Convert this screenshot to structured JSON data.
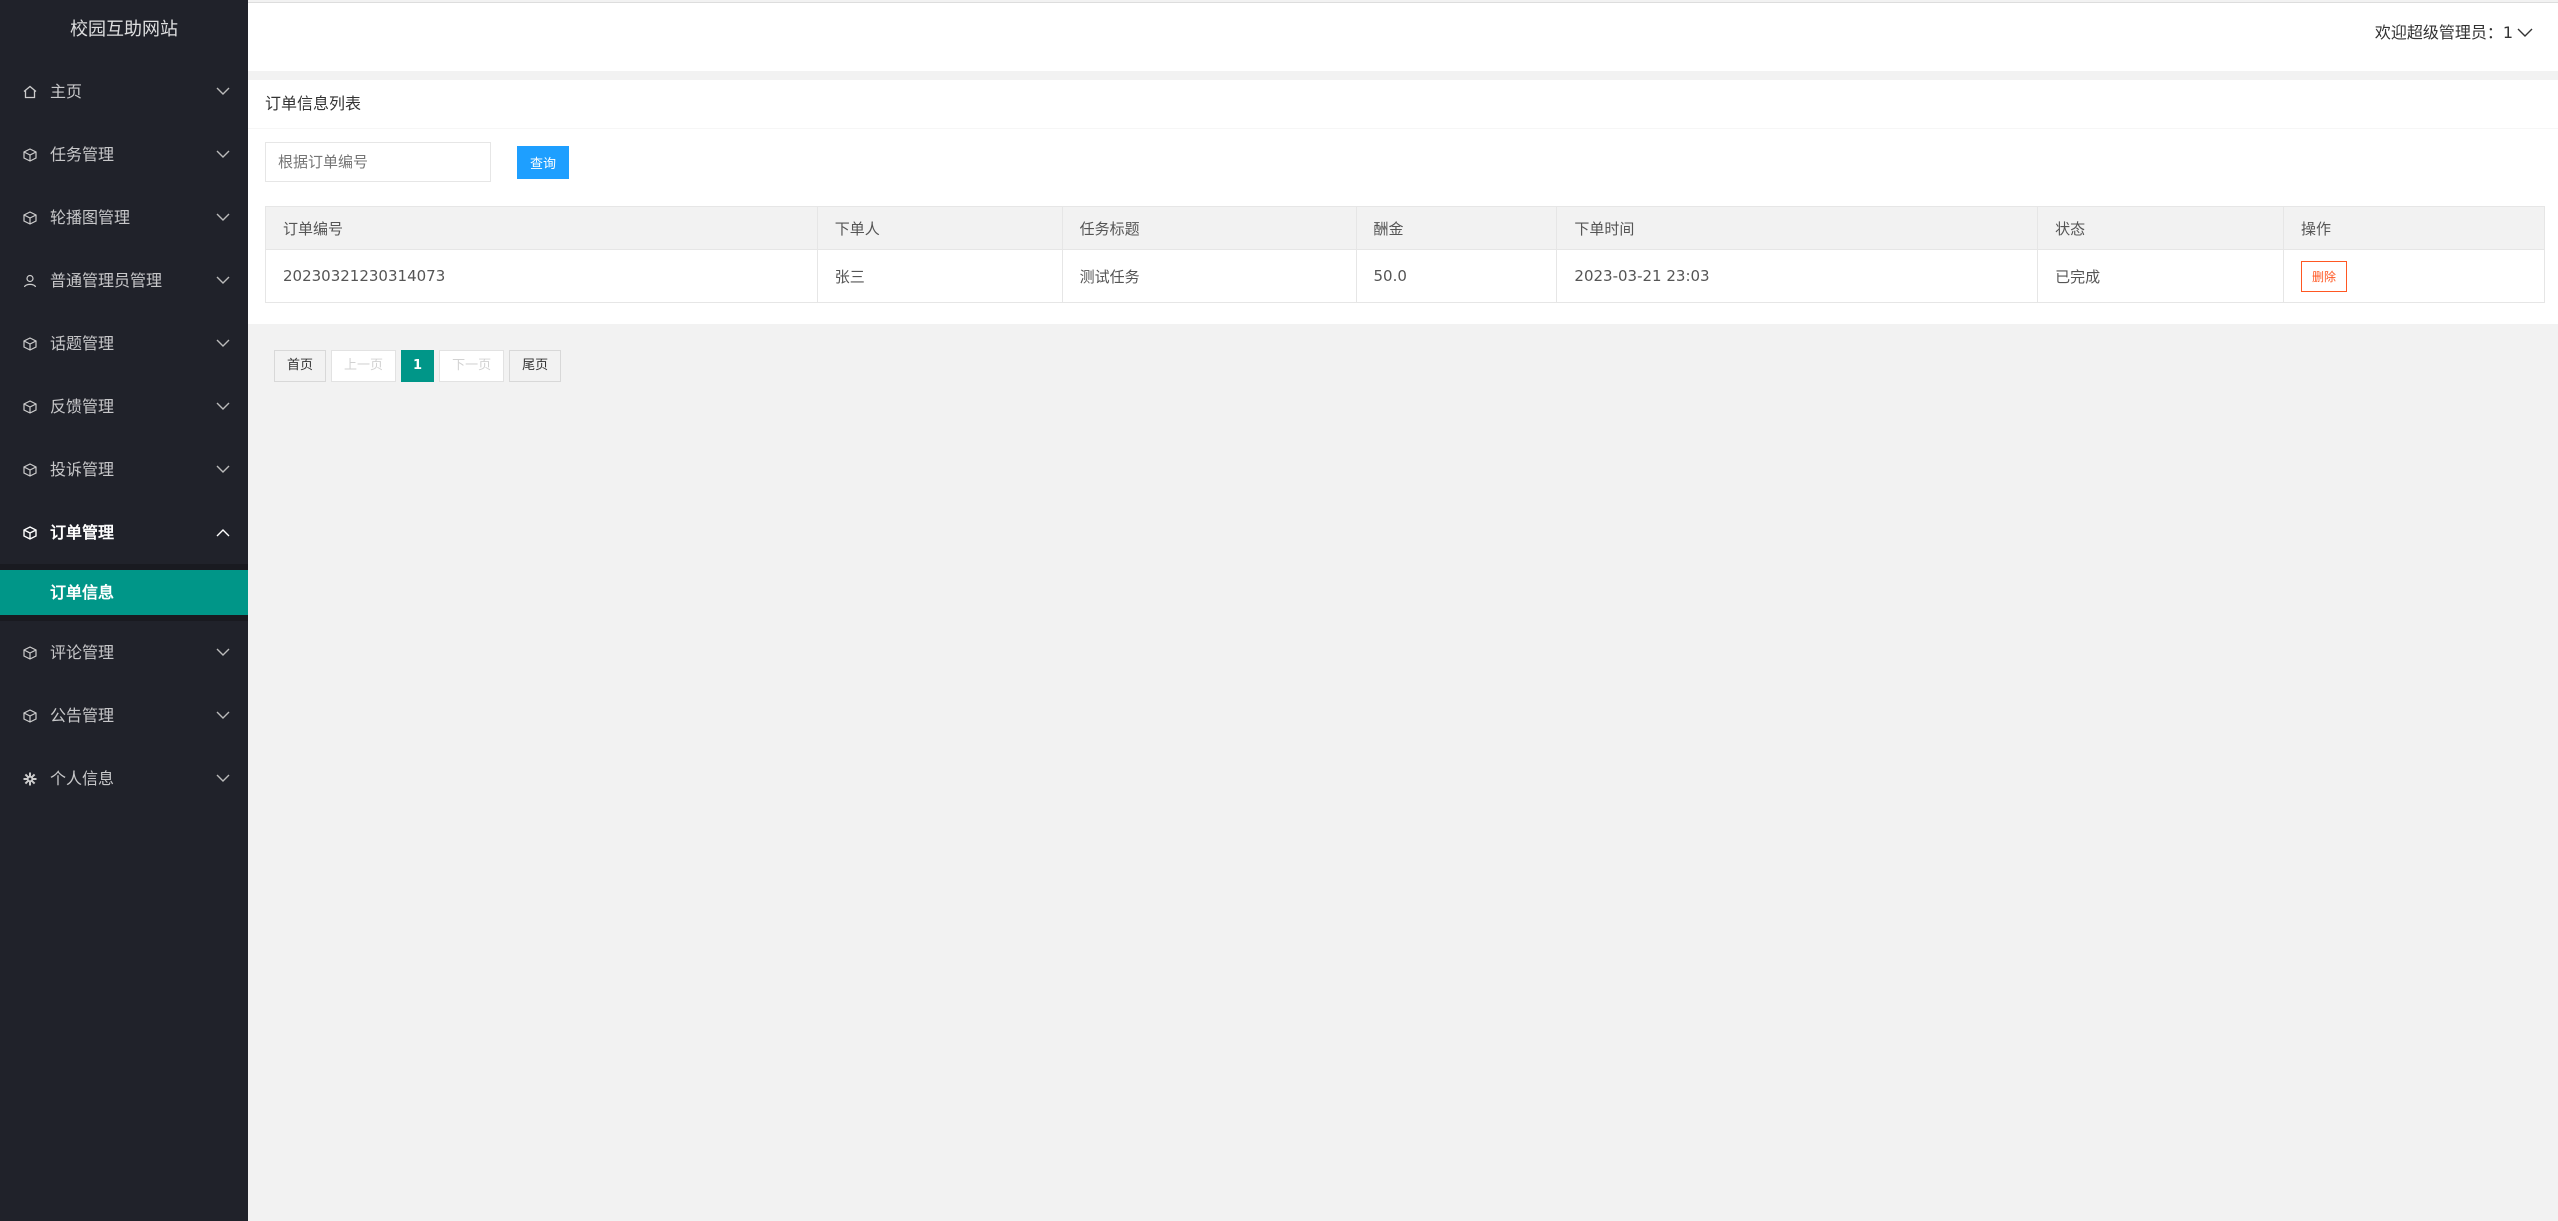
{
  "sidebar": {
    "logo": "校园互助网站",
    "items": [
      {
        "label": "主页",
        "icon": "home-icon"
      },
      {
        "label": "任务管理",
        "icon": "cube-icon"
      },
      {
        "label": "轮播图管理",
        "icon": "cube-icon"
      },
      {
        "label": "普通管理员管理",
        "icon": "user-icon"
      },
      {
        "label": "话题管理",
        "icon": "cube-icon"
      },
      {
        "label": "反馈管理",
        "icon": "cube-icon"
      },
      {
        "label": "投诉管理",
        "icon": "cube-icon"
      },
      {
        "label": "订单管理",
        "icon": "cube-icon",
        "expanded": true
      },
      {
        "label": "评论管理",
        "icon": "cube-icon"
      },
      {
        "label": "公告管理",
        "icon": "cube-icon"
      },
      {
        "label": "个人信息",
        "icon": "gear-icon"
      }
    ],
    "subitem": "订单信息"
  },
  "header": {
    "welcome": "欢迎超级管理员：1"
  },
  "main": {
    "title": "订单信息列表",
    "search": {
      "placeholder": "根据订单编号",
      "value": "",
      "button": "查询"
    },
    "table": {
      "columns": [
        "订单编号",
        "下单人",
        "任务标题",
        "酬金",
        "下单时间",
        "状态",
        "操作"
      ],
      "rows": [
        {
          "order_no": "20230321230314073",
          "user": "张三",
          "task": "测试任务",
          "reward": "50.0",
          "time": "2023-03-21 23:03",
          "status": "已完成",
          "action": "删除"
        }
      ]
    },
    "pager": {
      "first": "首页",
      "prev": "上一页",
      "current": "1",
      "next": "下一页",
      "last": "尾页"
    }
  },
  "colors": {
    "sidebar_bg": "#20222a",
    "accent": "#009688",
    "query_button": "#1e9fff",
    "delete_button": "#ff5722"
  }
}
